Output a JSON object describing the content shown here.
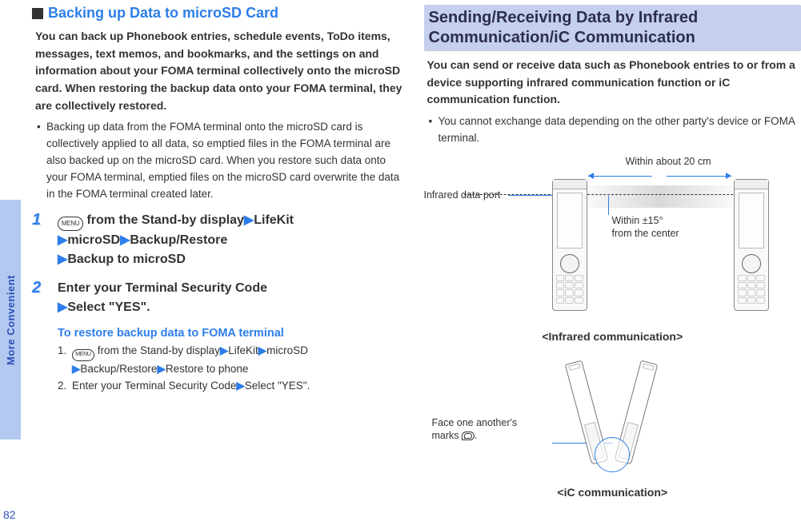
{
  "side_tab": "More Convenient",
  "page_number": "82",
  "left": {
    "sub_heading": "Backing up Data to microSD Card",
    "intro": "You can back up Phonebook entries, schedule events, ToDo items, messages, text memos, and bookmarks, and the settings on and information about your FOMA terminal collectively onto the microSD card. When restoring the backup data onto your FOMA terminal, they are collectively restored.",
    "bullet": "Backing up data from the FOMA terminal onto the microSD card is collectively applied to all data, so emptied files in the FOMA terminal are also backed up on the microSD card. When you restore such data onto your FOMA terminal, emptied files on the microSD card overwrite the data in the FOMA terminal created later.",
    "menu_label": "MENU",
    "step1": {
      "num": "1",
      "from_standby": " from the Stand-by display",
      "s1": "LifeKit",
      "s2": "microSD",
      "s3": "Backup/Restore",
      "s4": "Backup to microSD"
    },
    "step2": {
      "num": "2",
      "line1": "Enter your Terminal Security Code",
      "line2": "Select \"YES\".",
      "note_title": "To restore backup data to FOMA terminal",
      "sub1_n": "1.",
      "sub1_from": " from the Stand-by display",
      "sub1_a": "LifeKit",
      "sub1_b": "microSD",
      "sub1_c": "Backup/Restore",
      "sub1_d": "Restore to phone",
      "sub2_n": "2.",
      "sub2_t": "Enter your Terminal Security Code",
      "sub2_s": "Select \"YES\"."
    }
  },
  "right": {
    "heading": "Sending/Receiving Data by Infrared Communication/iC Communication",
    "intro": "You can send or receive data such as Phonebook entries to or from a device supporting infrared communication function or iC communication function.",
    "bullet": "You cannot exchange data depending on the other party's device or FOMA terminal.",
    "diagram": {
      "distance": "Within about 20 cm",
      "port": "Infrared data port",
      "angle_l1": "Within ±15°",
      "angle_l2": "from the center",
      "caption": "<Infrared communication>"
    },
    "ic": {
      "face_l1": "Face one another's",
      "face_l2_prefix": "marks ",
      "face_l2_suffix": ".",
      "caption": "<iC communication>"
    }
  }
}
